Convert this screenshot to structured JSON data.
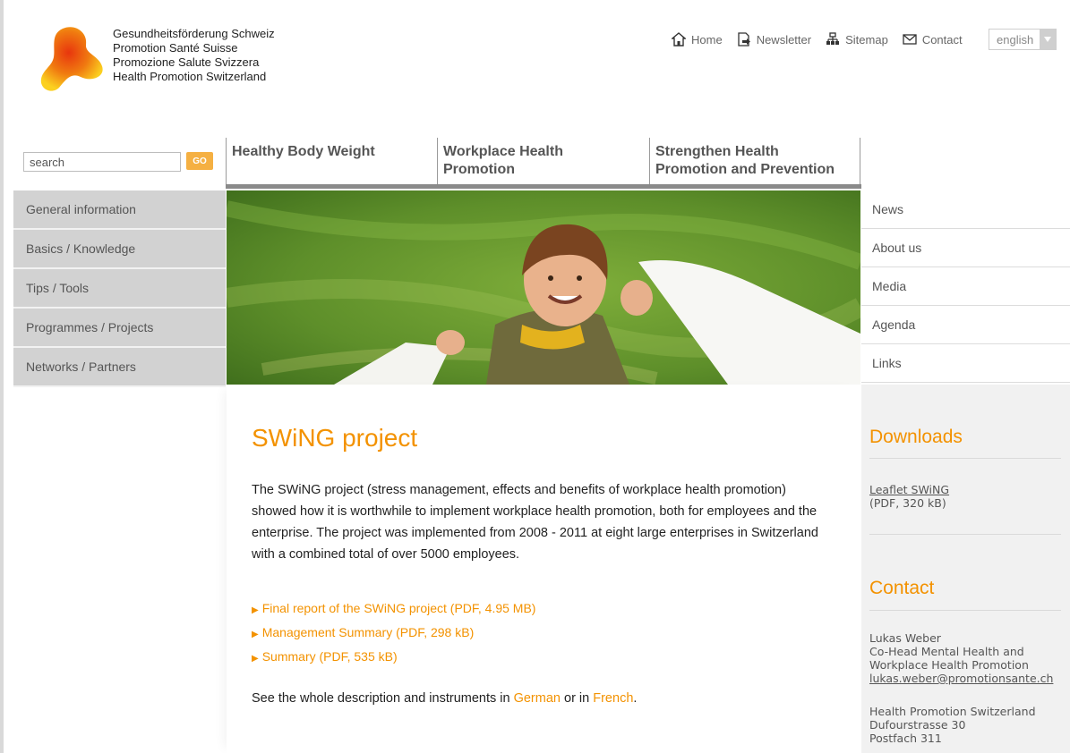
{
  "header": {
    "org_names": [
      "Gesundheitsförderung Schweiz",
      "Promotion Santé Suisse",
      "Promozione Salute Svizzera",
      "Health Promotion Switzerland"
    ],
    "links": [
      {
        "label": "Home",
        "icon": "home-icon"
      },
      {
        "label": "Newsletter",
        "icon": "newsletter-icon"
      },
      {
        "label": "Sitemap",
        "icon": "sitemap-icon"
      },
      {
        "label": "Contact",
        "icon": "envelope-icon"
      }
    ],
    "language": "english"
  },
  "search": {
    "placeholder": "search",
    "value": "search",
    "go_label": "GO"
  },
  "main_nav": [
    {
      "label_lines": [
        "Healthy Body Weight"
      ]
    },
    {
      "label_lines": [
        "Workplace Health",
        "Promotion"
      ]
    },
    {
      "label_lines": [
        "Strengthen Health",
        "Promotion and Prevention"
      ]
    }
  ],
  "left_nav": [
    "General information",
    "Basics / Knowledge",
    "Tips / Tools",
    "Programmes / Projects",
    "Networks / Partners"
  ],
  "right_nav": [
    "News",
    "About us",
    "Media",
    "Agenda",
    "Links"
  ],
  "content": {
    "title": "SWiNG project",
    "intro": "The SWiNG project (stress management, effects and benefits of workplace health promotion) showed how it is worthwhile to implement workplace health promotion, both for employees and the enterprise. The project was implemented from 2008 - 2011 at eight large enterprises in Switzerland with a combined total of over 5000 employees.",
    "links": [
      "Final report of the SWiNG project (PDF, 4.95 MB)",
      "Management Summary (PDF, 298 kB)",
      "Summary (PDF, 535 kB)"
    ],
    "see_prefix": "See the whole description and instruments in ",
    "see_german": "German",
    "see_mid": " or in ",
    "see_french": "French",
    "see_suffix": "."
  },
  "sidebar": {
    "downloads_title": "Downloads",
    "download_link": "Leaflet SWiNG",
    "download_meta": "(PDF, 320 kB)",
    "contact_title": "Contact",
    "contact_name": "Lukas Weber",
    "contact_role_1": "Co-Head Mental Health and",
    "contact_role_2": "Workplace Health Promotion",
    "contact_email": "lukas.weber@promotionsante.ch",
    "org_name": "Health Promotion Switzerland",
    "street": "Dufourstrasse 30",
    "postfach_partial": "Postfach 311"
  },
  "colors": {
    "accent": "#f39200",
    "nav_gray": "#d2d2d2",
    "bar_gray": "#8a8a8a"
  }
}
